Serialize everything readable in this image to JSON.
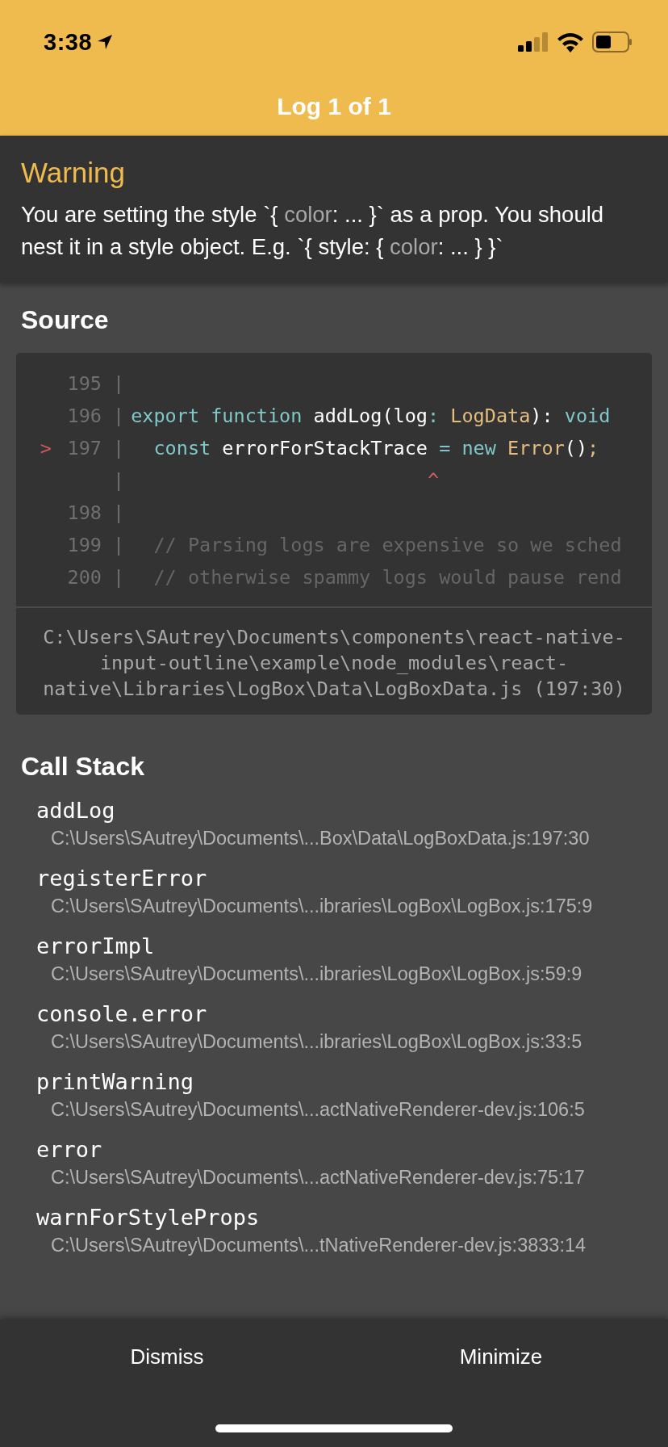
{
  "status_bar": {
    "time": "3:38"
  },
  "header": {
    "title": "Log 1 of 1"
  },
  "warning": {
    "level_label": "Warning",
    "message": [
      {
        "text": "You are setting the style `{ ",
        "kind": "plain"
      },
      {
        "text": "color",
        "kind": "substitution"
      },
      {
        "text": ": ... }` as a prop. You should nest it in a style object. E.g. `{ style: { ",
        "kind": "plain"
      },
      {
        "text": "color",
        "kind": "substitution"
      },
      {
        "text": ": ... } }`",
        "kind": "plain"
      }
    ]
  },
  "source": {
    "heading": "Source",
    "lines": [
      {
        "number": "195",
        "pointer": false,
        "separator": "|"
      },
      {
        "number": "196",
        "pointer": false,
        "separator": "|",
        "tokens": [
          {
            "text": "export function ",
            "kind": "keyword"
          },
          {
            "text": "addLog(log",
            "kind": "plain"
          },
          {
            "text": ": ",
            "kind": "keyword"
          },
          {
            "text": "LogData",
            "kind": "type"
          },
          {
            "text": "): ",
            "kind": "plain"
          },
          {
            "text": "void",
            "kind": "keyword"
          }
        ]
      },
      {
        "number": "197",
        "pointer": true,
        "pointer_mark": ">",
        "separator": "|",
        "tokens": [
          {
            "text": "  const ",
            "kind": "keyword"
          },
          {
            "text": "errorForStackTrace ",
            "kind": "plain"
          },
          {
            "text": "= new ",
            "kind": "keyword"
          },
          {
            "text": "Error",
            "kind": "type"
          },
          {
            "text": "()",
            "kind": "plain"
          },
          {
            "text": ";",
            "kind": "type"
          }
        ]
      },
      {
        "pointer": false,
        "separator": "|",
        "tokens": [
          {
            "text": "                          ^",
            "kind": "caret"
          }
        ]
      },
      {
        "number": "198",
        "pointer": false,
        "separator": "|"
      },
      {
        "number": "199",
        "pointer": false,
        "separator": "|",
        "tokens": [
          {
            "text": "  // Parsing logs are expensive so we sched",
            "kind": "comment"
          }
        ]
      },
      {
        "number": "200",
        "pointer": false,
        "separator": "|",
        "tokens": [
          {
            "text": "  // otherwise spammy logs would pause rend",
            "kind": "comment"
          }
        ]
      }
    ],
    "file_path": "C:\\Users\\SAutrey\\Documents\\components\\react-native-input-outline\\example\\node_modules\\react-native\\Libraries\\LogBox\\Data\\LogBoxData.js (197:30)"
  },
  "call_stack": {
    "heading": "Call Stack",
    "frames": [
      {
        "method": "addLog",
        "location": "C:\\Users\\SAutrey\\Documents\\...Box\\Data\\LogBoxData.js:197:30"
      },
      {
        "method": "registerError",
        "location": "C:\\Users\\SAutrey\\Documents\\...ibraries\\LogBox\\LogBox.js:175:9"
      },
      {
        "method": "errorImpl",
        "location": "C:\\Users\\SAutrey\\Documents\\...ibraries\\LogBox\\LogBox.js:59:9"
      },
      {
        "method": "console.error",
        "location": "C:\\Users\\SAutrey\\Documents\\...ibraries\\LogBox\\LogBox.js:33:5"
      },
      {
        "method": "printWarning",
        "location": "C:\\Users\\SAutrey\\Documents\\...actNativeRenderer-dev.js:106:5"
      },
      {
        "method": "error",
        "location": "C:\\Users\\SAutrey\\Documents\\...actNativeRenderer-dev.js:75:17"
      },
      {
        "method": "warnForStyleProps",
        "location": "C:\\Users\\SAutrey\\Documents\\...tNativeRenderer-dev.js:3833:14"
      }
    ]
  },
  "footer": {
    "buttons": [
      "Dismiss",
      "Minimize"
    ]
  }
}
